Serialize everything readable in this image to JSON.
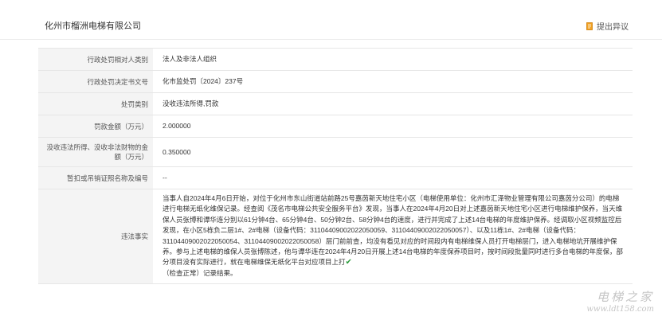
{
  "header": {
    "company": "化州市榴洲电梯有限公司",
    "objection_label": "提出异议",
    "objection_icon": "document-edit-icon"
  },
  "rows": [
    {
      "label": "行政处罚相对人类别",
      "value": "法人及非法人组织"
    },
    {
      "label": "行政处罚决定书文号",
      "value": "化市监处罚〔2024〕237号"
    },
    {
      "label": "处罚类别",
      "value": "没收违法所得,罚款"
    },
    {
      "label": "罚款金额（万元）",
      "value": "2.000000"
    },
    {
      "label": "没收违法所得、没收非法财物的金额（万元）",
      "value": "0.350000"
    },
    {
      "label": "暂扣或吊销证照名称及编号",
      "value": "--"
    }
  ],
  "facts": {
    "label": "违法事实",
    "text": "当事人自2024年4月6日开始，对位于化州市东山街道站前路25号嘉茵新天地住宅小区（电梯使用单位：化州市汇泽物业管理有限公司嘉茵分公司）的电梯进行电梯无纸化维保记录。经查阅《茂名市电梯公共安全服务平台》发现，当事人在2024年4月20日对上述嘉茵新天地住宅小区进行电梯维护保养，当天维保人员张博和谭华连分别以61分钟4台、65分钟4台、50分钟2台、58分钟4台的速度，进行并完成了上述14台电梯的年度维护保养。经调取小区视频监控后发现，在小区5栋负二层1#、2#电梯（设备代码：31104409002022050059、31104409002022050057）、以及11栋1#、2#电梯（设备代码：31104409002022050054、31104409002022050058）层门前前查，均没有看见对应的时间段内有电梯维保人员打开电梯层门，进入电梯地坑开展维护保养。参与上述电梯的维保人员张博陈述，他与谭华连在2024年4月20日开展上述14台电梯的年度保养项目时，按时间段批量同时进行多台电梯的年度保，部分项目没有实际进行，就在电梯维保无纸化平台对应项目上打",
    "check_icon": "check-mark-icon",
    "tail": "（检查正常）记录结果。"
  },
  "watermark": {
    "brand": "电梯之家",
    "url": "www.ldt158.com"
  }
}
